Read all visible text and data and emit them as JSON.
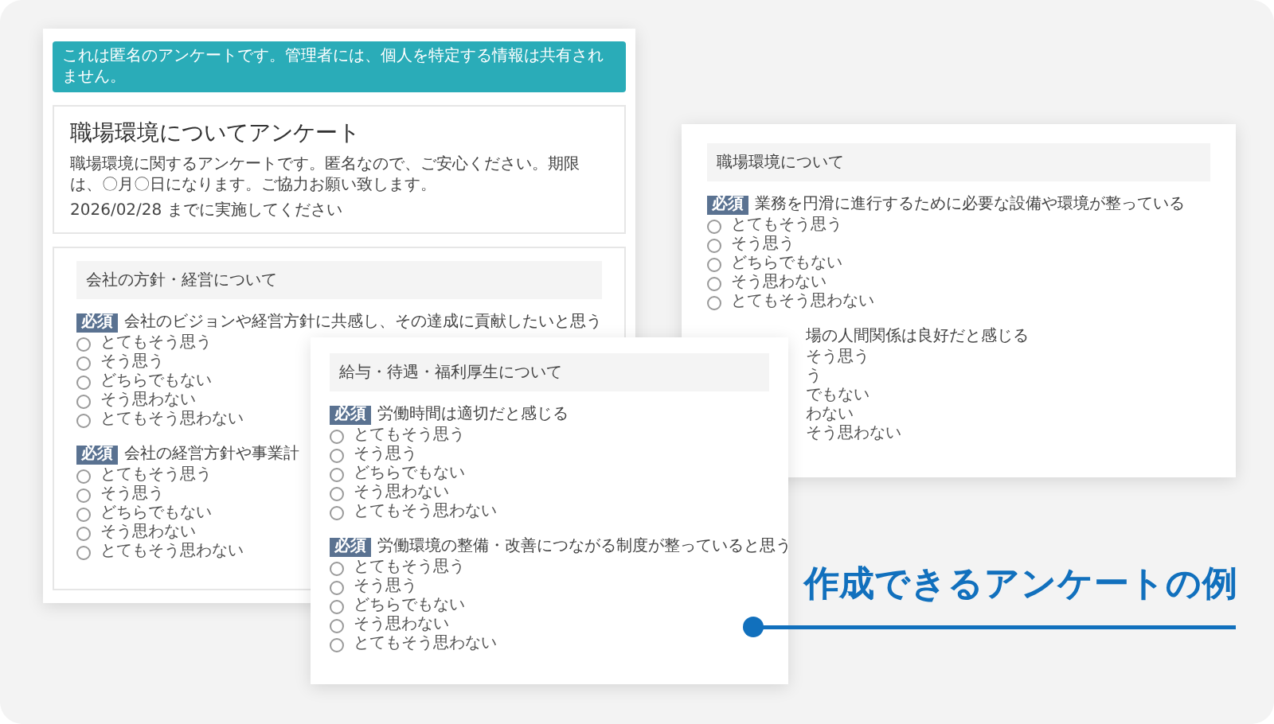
{
  "windows": [
    {
      "kind": "intro",
      "notice": "これは匿名のアンケートです。管理者には、個人を特定する情報は共有されません。",
      "title": "職場環境についてアンケート",
      "description": "職場環境に関するアンケートです。匿名なので、ご安心ください。期限は、〇月〇日になります。ご協力お願い致します。",
      "deadline": "2026/02/28 までに実施してください",
      "sections": [
        {
          "title": "会社の方針・経営について",
          "questions": [
            {
              "kind": "full",
              "badge": "必須",
              "text": "会社のビジョンや経営方針に共感し、その達成に貢献したいと思う",
              "options": [
                {
                  "label": "とてもそう思う",
                  "selected": false
                },
                {
                  "label": "そう思う",
                  "selected": false
                },
                {
                  "label": "どちらでもない",
                  "selected": false
                },
                {
                  "label": "そう思わない",
                  "selected": false
                },
                {
                  "label": "とてもそう思わない",
                  "selected": false
                }
              ]
            },
            {
              "kind": "full",
              "badge": "必須",
              "text": "会社の経営方針や事業計",
              "options": [
                {
                  "label": "とてもそう思う",
                  "selected": false
                },
                {
                  "label": "そう思う",
                  "selected": false
                },
                {
                  "label": "どちらでもない",
                  "selected": false
                },
                {
                  "label": "そう思わない",
                  "selected": false
                },
                {
                  "label": "とてもそう思わない",
                  "selected": false
                }
              ]
            }
          ]
        }
      ]
    },
    {
      "kind": "plain",
      "sections": [
        {
          "title": "職場環境について",
          "questions": [
            {
              "kind": "full",
              "badge": "必須",
              "text": "業務を円滑に進行するために必要な設備や環境が整っている",
              "options": [
                {
                  "label": "とてもそう思う",
                  "selected": false
                },
                {
                  "label": "そう思う",
                  "selected": false
                },
                {
                  "label": "どちらでもない",
                  "selected": false
                },
                {
                  "label": "そう思わない",
                  "selected": false
                },
                {
                  "label": "とてもそう思わない",
                  "selected": false
                }
              ]
            },
            {
              "kind": "clipped",
              "text": "場の人間関係は良好だと感じる",
              "options": [
                {
                  "label": "そう思う"
                },
                {
                  "label": "う"
                },
                {
                  "label": "でもない"
                },
                {
                  "label": "わない"
                },
                {
                  "label": "そう思わない"
                }
              ]
            }
          ]
        }
      ]
    },
    {
      "kind": "plain",
      "sections": [
        {
          "title": "給与・待遇・福利厚生について",
          "questions": [
            {
              "kind": "full",
              "badge": "必須",
              "text": "労働時間は適切だと感じる",
              "options": [
                {
                  "label": "とてもそう思う",
                  "selected": false
                },
                {
                  "label": "そう思う",
                  "selected": false
                },
                {
                  "label": "どちらでもない",
                  "selected": false
                },
                {
                  "label": "そう思わない",
                  "selected": false
                },
                {
                  "label": "とてもそう思わない",
                  "selected": false
                }
              ]
            },
            {
              "kind": "full",
              "badge": "必須",
              "text": "労働環境の整備・改善につながる制度が整っていると思う",
              "options": [
                {
                  "label": "とてもそう思う",
                  "selected": false
                },
                {
                  "label": "そう思う",
                  "selected": false
                },
                {
                  "label": "どちらでもない",
                  "selected": false
                },
                {
                  "label": "そう思わない",
                  "selected": false
                },
                {
                  "label": "とてもそう思わない",
                  "selected": false
                }
              ]
            }
          ]
        }
      ]
    }
  ],
  "caption": "作成できるアンケートの例"
}
